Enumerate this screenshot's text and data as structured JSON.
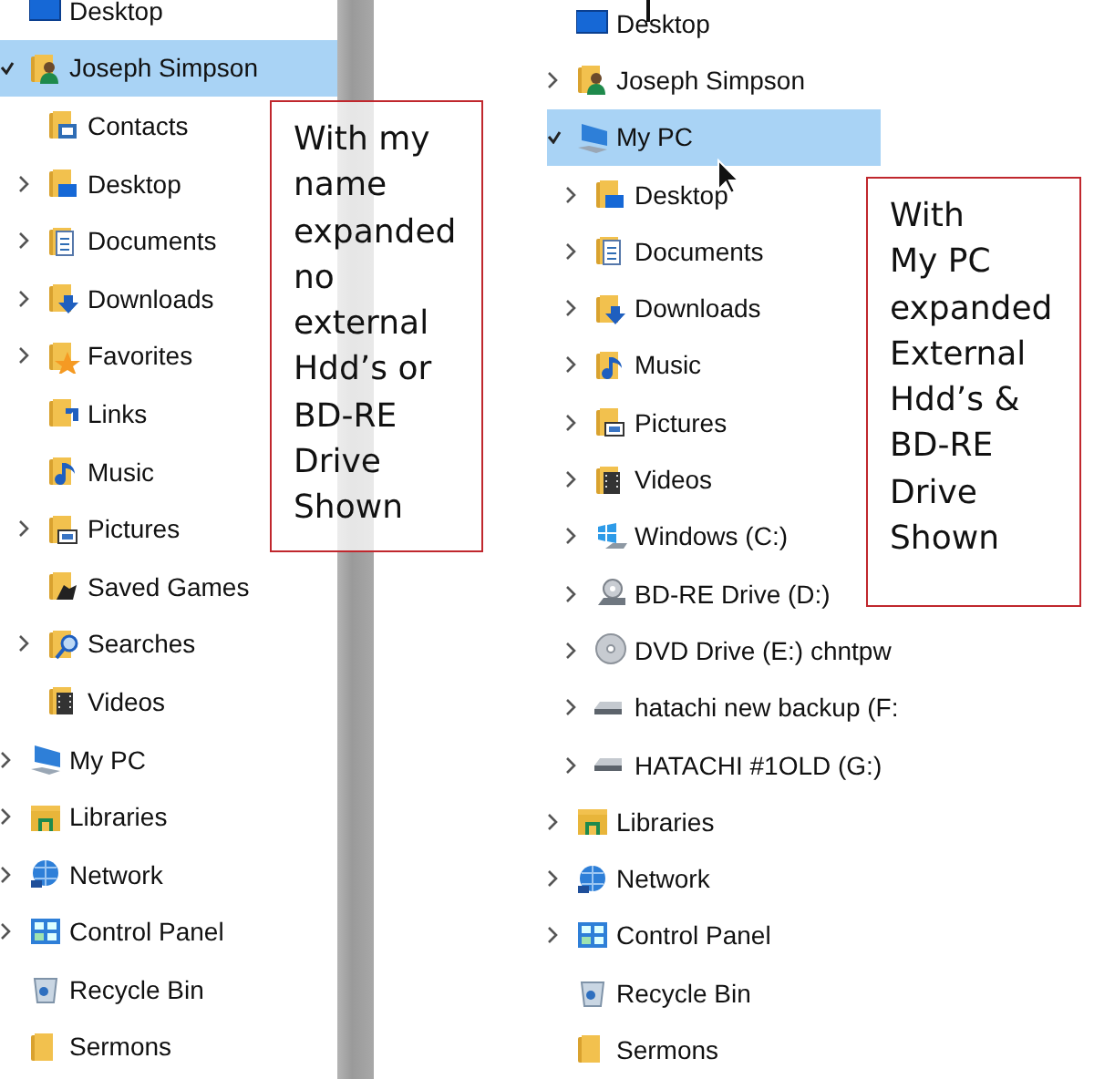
{
  "left_pane": {
    "items": [
      {
        "label": "Desktop",
        "kind": "desktop",
        "expandable": false,
        "selected": false
      },
      {
        "label": "Joseph Simpson",
        "kind": "user",
        "expandable": true,
        "expanded": true,
        "selected": true,
        "children": [
          {
            "label": "Contacts",
            "kind": "contacts",
            "expandable": false,
            "selected": false
          },
          {
            "label": "Desktop",
            "kind": "desktopfolder",
            "expandable": true,
            "expanded": false,
            "selected": false
          },
          {
            "label": "Documents",
            "kind": "documents",
            "expandable": true,
            "expanded": false,
            "selected": false
          },
          {
            "label": "Downloads",
            "kind": "downloads",
            "expandable": true,
            "expanded": false,
            "selected": false
          },
          {
            "label": "Favorites",
            "kind": "favorites",
            "expandable": true,
            "expanded": false,
            "selected": false
          },
          {
            "label": "Links",
            "kind": "links",
            "expandable": false,
            "selected": false
          },
          {
            "label": "Music",
            "kind": "music",
            "expandable": false,
            "selected": false
          },
          {
            "label": "Pictures",
            "kind": "pictures",
            "expandable": true,
            "expanded": false,
            "selected": false
          },
          {
            "label": "Saved Games",
            "kind": "games",
            "expandable": false,
            "selected": false
          },
          {
            "label": "Searches",
            "kind": "searches",
            "expandable": true,
            "expanded": false,
            "selected": false
          },
          {
            "label": "Videos",
            "kind": "videos",
            "expandable": false,
            "selected": false
          }
        ]
      },
      {
        "label": "My PC",
        "kind": "pc",
        "expandable": true,
        "expanded": false,
        "selected": false
      },
      {
        "label": "Libraries",
        "kind": "libraries",
        "expandable": true,
        "expanded": false,
        "selected": false
      },
      {
        "label": "Network",
        "kind": "network",
        "expandable": true,
        "expanded": false,
        "selected": false
      },
      {
        "label": "Control Panel",
        "kind": "controlpanel",
        "expandable": true,
        "expanded": false,
        "selected": false
      },
      {
        "label": "Recycle Bin",
        "kind": "recycle",
        "expandable": false,
        "selected": false
      },
      {
        "label": "Sermons",
        "kind": "folder",
        "expandable": false,
        "selected": false
      }
    ]
  },
  "left_note": {
    "text": "With my\nname\nexpanded\nno\nexternal\nHdd’s or\nBD-RE\nDrive\nShown"
  },
  "right_pane": {
    "items": [
      {
        "label": "Desktop",
        "kind": "desktop",
        "expandable": false,
        "selected": false
      },
      {
        "label": "Joseph Simpson",
        "kind": "user",
        "expandable": true,
        "expanded": false,
        "selected": false
      },
      {
        "label": "My PC",
        "kind": "pc",
        "expandable": true,
        "expanded": true,
        "selected": true,
        "children": [
          {
            "label": "Desktop",
            "kind": "desktopfolder",
            "expandable": true,
            "expanded": false,
            "selected": false
          },
          {
            "label": "Documents",
            "kind": "documents",
            "expandable": true,
            "expanded": false,
            "selected": false
          },
          {
            "label": "Downloads",
            "kind": "downloads",
            "expandable": true,
            "expanded": false,
            "selected": false
          },
          {
            "label": "Music",
            "kind": "music",
            "expandable": true,
            "expanded": false,
            "selected": false
          },
          {
            "label": "Pictures",
            "kind": "pictures",
            "expandable": true,
            "expanded": false,
            "selected": false
          },
          {
            "label": "Videos",
            "kind": "videos",
            "expandable": true,
            "expanded": false,
            "selected": false
          },
          {
            "label": "Windows (C:)",
            "kind": "windrive",
            "expandable": true,
            "expanded": false,
            "selected": false
          },
          {
            "label": "BD-RE Drive (D:)",
            "kind": "bddrive",
            "expandable": true,
            "expanded": false,
            "selected": false
          },
          {
            "label": "DVD Drive (E:) chntpw",
            "kind": "dvddrive",
            "expandable": true,
            "expanded": false,
            "selected": false
          },
          {
            "label": "hatachi new backup (F:",
            "kind": "drive",
            "expandable": true,
            "expanded": false,
            "selected": false
          },
          {
            "label": "HATACHI #1OLD (G:)",
            "kind": "drive",
            "expandable": true,
            "expanded": false,
            "selected": false
          }
        ]
      },
      {
        "label": "Libraries",
        "kind": "libraries",
        "expandable": true,
        "expanded": false,
        "selected": false
      },
      {
        "label": "Network",
        "kind": "network",
        "expandable": true,
        "expanded": false,
        "selected": false
      },
      {
        "label": "Control Panel",
        "kind": "controlpanel",
        "expandable": true,
        "expanded": false,
        "selected": false
      },
      {
        "label": "Recycle Bin",
        "kind": "recycle",
        "expandable": false,
        "selected": false
      },
      {
        "label": "Sermons",
        "kind": "folder",
        "expandable": false,
        "selected": false
      }
    ]
  },
  "right_note": {
    "text": "With\nMy PC\nexpanded\nExternal\nHdd’s &\nBD-RE\nDrive\nShown"
  }
}
